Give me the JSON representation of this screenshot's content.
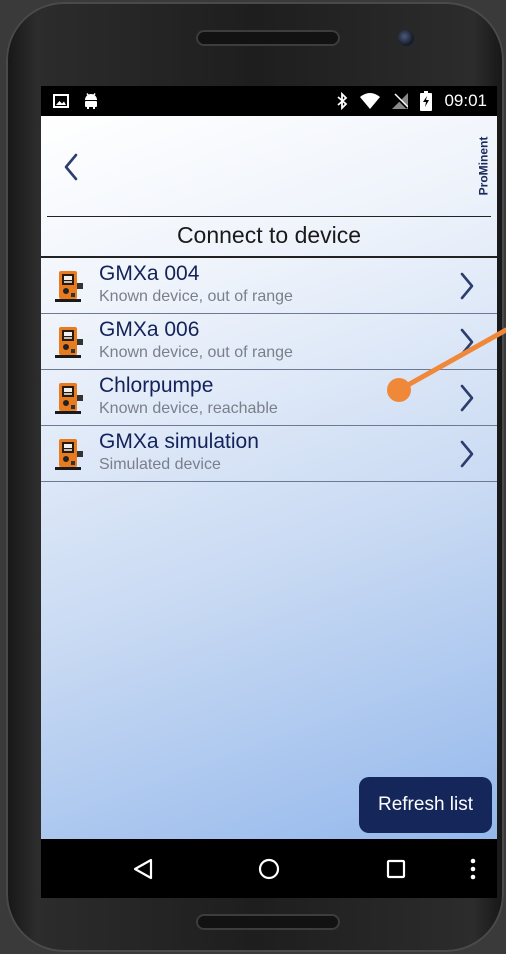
{
  "status_bar": {
    "time": "09:01",
    "icons": [
      "image-icon",
      "android-icon",
      "bluetooth-icon",
      "wifi-icon",
      "no-sim-icon",
      "battery-charging-icon"
    ]
  },
  "header": {
    "back_icon": "chevron-left-icon",
    "logo_text": "ProMinent"
  },
  "main": {
    "title": "Connect to device",
    "devices": [
      {
        "name": "GMXa 004",
        "status": "Known device, out of range"
      },
      {
        "name": "GMXa 006",
        "status": "Known device, out of range"
      },
      {
        "name": "Chlorpumpe",
        "status": "Known device, reachable"
      },
      {
        "name": "GMXa simulation",
        "status": "Simulated device"
      }
    ],
    "refresh_label": "Refresh list"
  },
  "nav_bar": {
    "icons": [
      "back-triangle-icon",
      "home-circle-icon",
      "recents-square-icon",
      "overflow-menu-icon"
    ]
  },
  "colors": {
    "accent_navy": "#14265a",
    "annotation_orange": "#f0883a"
  }
}
